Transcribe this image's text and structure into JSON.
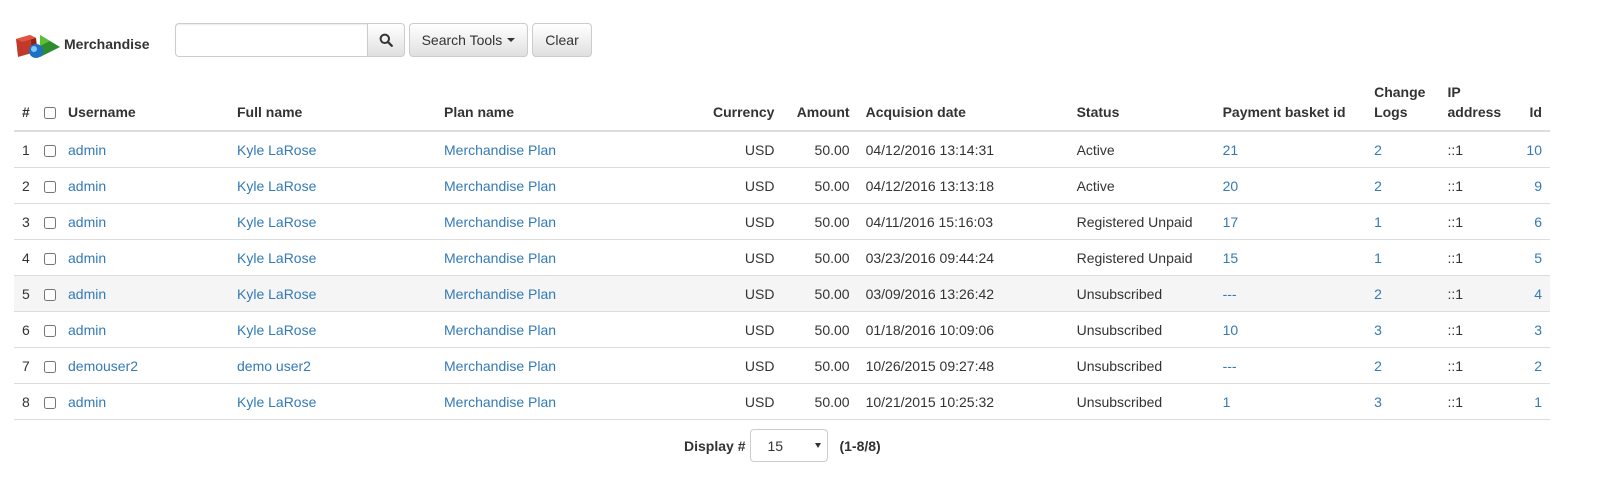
{
  "brand": {
    "title": "Merchandise"
  },
  "toolbar": {
    "search_value": "",
    "search_tools_label": "Search Tools",
    "clear_label": "Clear"
  },
  "table": {
    "headers": {
      "index": "#",
      "username": "Username",
      "fullname": "Full name",
      "planname": "Plan name",
      "currency": "Currency",
      "amount": "Amount",
      "acq_date": "Acquision date",
      "status": "Status",
      "basket": "Payment basket id",
      "changelogs_1": "Change",
      "changelogs_2": "Logs",
      "ip_1": "IP",
      "ip_2": "address",
      "id": "Id"
    },
    "rows": [
      {
        "index": "1",
        "username": "admin",
        "fullname": "Kyle LaRose",
        "plan": "Merchandise Plan",
        "currency": "USD",
        "amount": "50.00",
        "date": "04/12/2016 13:14:31",
        "status": "Active",
        "basket": "21",
        "logs": "2",
        "ip": "::1",
        "id": "10"
      },
      {
        "index": "2",
        "username": "admin",
        "fullname": "Kyle LaRose",
        "plan": "Merchandise Plan",
        "currency": "USD",
        "amount": "50.00",
        "date": "04/12/2016 13:13:18",
        "status": "Active",
        "basket": "20",
        "logs": "2",
        "ip": "::1",
        "id": "9"
      },
      {
        "index": "3",
        "username": "admin",
        "fullname": "Kyle LaRose",
        "plan": "Merchandise Plan",
        "currency": "USD",
        "amount": "50.00",
        "date": "04/11/2016 15:16:03",
        "status": "Registered Unpaid",
        "basket": "17",
        "logs": "1",
        "ip": "::1",
        "id": "6"
      },
      {
        "index": "4",
        "username": "admin",
        "fullname": "Kyle LaRose",
        "plan": "Merchandise Plan",
        "currency": "USD",
        "amount": "50.00",
        "date": "03/23/2016 09:44:24",
        "status": "Registered Unpaid",
        "basket": "15",
        "logs": "1",
        "ip": "::1",
        "id": "5"
      },
      {
        "index": "5",
        "username": "admin",
        "fullname": "Kyle LaRose",
        "plan": "Merchandise Plan",
        "currency": "USD",
        "amount": "50.00",
        "date": "03/09/2016 13:26:42",
        "status": "Unsubscribed",
        "basket": "---",
        "logs": "2",
        "ip": "::1",
        "id": "4"
      },
      {
        "index": "6",
        "username": "admin",
        "fullname": "Kyle LaRose",
        "plan": "Merchandise Plan",
        "currency": "USD",
        "amount": "50.00",
        "date": "01/18/2016 10:09:06",
        "status": "Unsubscribed",
        "basket": "10",
        "logs": "3",
        "ip": "::1",
        "id": "3"
      },
      {
        "index": "7",
        "username": "demouser2",
        "fullname": "demo user2",
        "plan": "Merchandise Plan",
        "currency": "USD",
        "amount": "50.00",
        "date": "10/26/2015 09:27:48",
        "status": "Unsubscribed",
        "basket": "---",
        "logs": "2",
        "ip": "::1",
        "id": "2"
      },
      {
        "index": "8",
        "username": "admin",
        "fullname": "Kyle LaRose",
        "plan": "Merchandise Plan",
        "currency": "USD",
        "amount": "50.00",
        "date": "10/21/2015 10:25:32",
        "status": "Unsubscribed",
        "basket": "1",
        "logs": "3",
        "ip": "::1",
        "id": "1"
      }
    ]
  },
  "pager": {
    "label": "Display #",
    "selected": "15",
    "range": "(1-8/8)"
  },
  "colors": {
    "link": "#337ab7",
    "border": "#dddddd",
    "highlight_row": "#f5f5f5"
  },
  "icons": {
    "brand": "merchandise-icon",
    "search": "magnifier-icon",
    "dropdown": "caret-down-icon"
  }
}
